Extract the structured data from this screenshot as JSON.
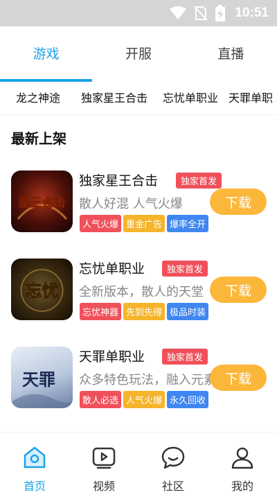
{
  "status_bar": {
    "time": "10:51"
  },
  "tabs": [
    {
      "label": "游戏",
      "active": true
    },
    {
      "label": "开服",
      "active": false
    },
    {
      "label": "直播",
      "active": false
    }
  ],
  "subtabs": [
    "龙之神途",
    "独家星王合击",
    "忘忧单职业",
    "天罪单职"
  ],
  "section": {
    "title": "最新上架"
  },
  "games": [
    {
      "name": "独家星王合击",
      "badge": "独家首发",
      "desc": "散人好混 人气火爆",
      "tags": [
        "人气火爆",
        "重金广告",
        "爆率全开"
      ],
      "download_label": "下载",
      "thumb_text": "星王合击"
    },
    {
      "name": "忘忧单职业",
      "badge": "独家首发",
      "desc": "全新版本，散人的天堂",
      "tags": [
        "忘忧神器",
        "先到先得",
        "极品时装"
      ],
      "download_label": "下载",
      "thumb_text": "忘忧"
    },
    {
      "name": "天罪单职业",
      "badge": "独家首发",
      "desc": "众多特色玩法，融入元素元",
      "tags": [
        "散人必选",
        "人气火爆",
        "永久回收"
      ],
      "download_label": "下载",
      "thumb_text": "天罪"
    }
  ],
  "bottom_nav": [
    {
      "label": "首页",
      "icon": "home-icon",
      "active": true
    },
    {
      "label": "视频",
      "icon": "video-icon",
      "active": false
    },
    {
      "label": "社区",
      "icon": "chat-icon",
      "active": false
    },
    {
      "label": "我的",
      "icon": "user-icon",
      "active": false
    }
  ],
  "colors": {
    "accent": "#1aa3e8",
    "badge_red": "#f0505a",
    "tag_yellow": "#f5b42a",
    "tag_blue": "#3f86f0",
    "download": "#fbb73a"
  }
}
